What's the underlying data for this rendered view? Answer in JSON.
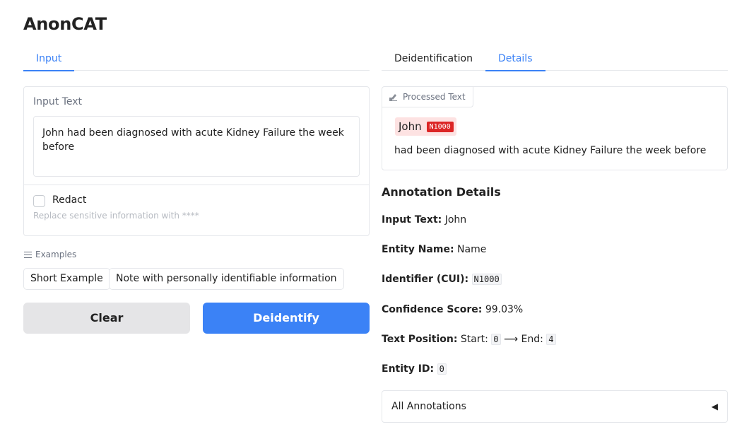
{
  "app": {
    "title": "AnonCAT"
  },
  "left_tabs": [
    {
      "label": "Input",
      "active": true
    }
  ],
  "right_tabs": [
    {
      "label": "Deidentification",
      "active": false
    },
    {
      "label": "Details",
      "active": true
    }
  ],
  "input": {
    "label": "Input Text",
    "value": "John had been diagnosed with acute Kidney Failure the week before",
    "redact_label": "Redact",
    "redact_info": "Replace sensitive information with ****",
    "redact_checked": false
  },
  "examples": {
    "header": "Examples",
    "items": [
      "Short Example",
      "Note with personally identifiable information"
    ]
  },
  "buttons": {
    "clear": "Clear",
    "deidentify": "Deidentify"
  },
  "processed": {
    "label": "Processed Text",
    "highlight_text": "John",
    "highlight_tag": "N1000",
    "rest_text": "had been diagnosed with acute Kidney Failure the week before"
  },
  "annotation": {
    "title": "Annotation Details",
    "input_text_label": "Input Text:",
    "input_text_value": "John",
    "entity_name_label": "Entity Name:",
    "entity_name_value": "Name",
    "cui_label": "Identifier (CUI):",
    "cui_value": "N1000",
    "confidence_label": "Confidence Score:",
    "confidence_value": "99.03%",
    "position_label": "Text Position:",
    "start_label": "Start:",
    "start_value": "0",
    "arrow": "⟶",
    "end_label": "End:",
    "end_value": "4",
    "entity_id_label": "Entity ID:",
    "entity_id_value": "0"
  },
  "all_annotations": {
    "label": "All Annotations",
    "caret": "◀"
  },
  "colors": {
    "accent": "#3b82f6",
    "tag": "#dc2626",
    "highlight": "#fde2e2"
  }
}
